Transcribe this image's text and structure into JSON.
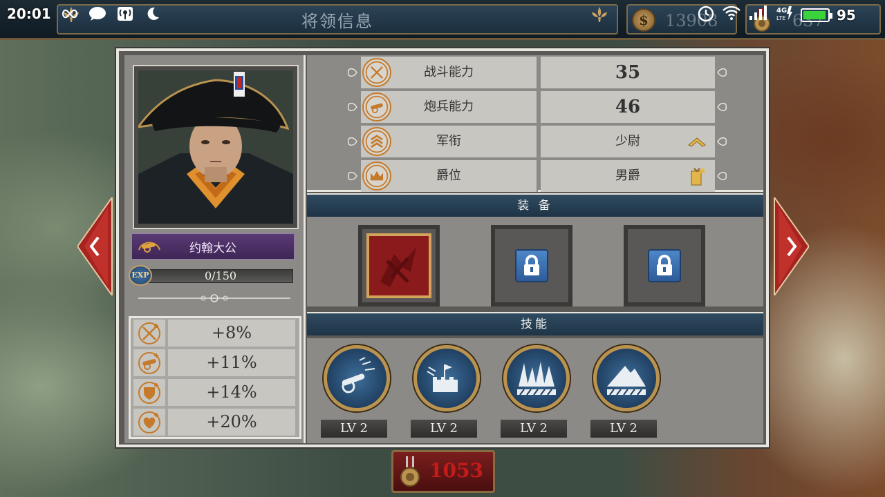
{
  "status_bar": {
    "time": "20:01",
    "battery_level": "95"
  },
  "header": {
    "title": "将领信息",
    "currency": "13908",
    "medals": "637"
  },
  "general": {
    "name": "约翰大公",
    "exp": "0/150",
    "exp_badge": "EXP"
  },
  "bonuses": [
    {
      "icon": "crossed-swords-icon",
      "value": "+8%"
    },
    {
      "icon": "cannon-icon",
      "value": "+11%"
    },
    {
      "icon": "shield-icon",
      "value": "+14%"
    },
    {
      "icon": "heart-icon",
      "value": "+20%"
    }
  ],
  "stats": [
    {
      "label": "战斗能力",
      "value": "35",
      "icon": "crossed-swords-icon"
    },
    {
      "label": "炮兵能力",
      "value": "46",
      "icon": "cannon-icon"
    },
    {
      "label": "军衔",
      "value": "少尉",
      "icon": "chevron-rank-icon"
    },
    {
      "label": "爵位",
      "value": "男爵",
      "icon": "crown-icon"
    }
  ],
  "equipment": {
    "heading": "装  备",
    "slots": [
      {
        "state": "equipped",
        "icon": "red-emblem-icon"
      },
      {
        "state": "locked",
        "icon": "lock-icon"
      },
      {
        "state": "locked",
        "icon": "lock-icon"
      }
    ]
  },
  "skills": {
    "heading": "技能",
    "items": [
      {
        "icon": "artillery-skill-icon",
        "level": "LV 2"
      },
      {
        "icon": "fortress-skill-icon",
        "level": "LV 2"
      },
      {
        "icon": "spikes-skill-icon",
        "level": "LV 2"
      },
      {
        "icon": "mountain-skill-icon",
        "level": "LV 2"
      }
    ]
  },
  "bottom": {
    "medal_value": "1053"
  },
  "colors": {
    "accent_gold": "#c47a2a",
    "section_blue": "#2f4a60",
    "name_plate_purple": "#5a3a74",
    "arrow_red": "#c0312c",
    "bottom_value_red": "#c41b1b"
  }
}
